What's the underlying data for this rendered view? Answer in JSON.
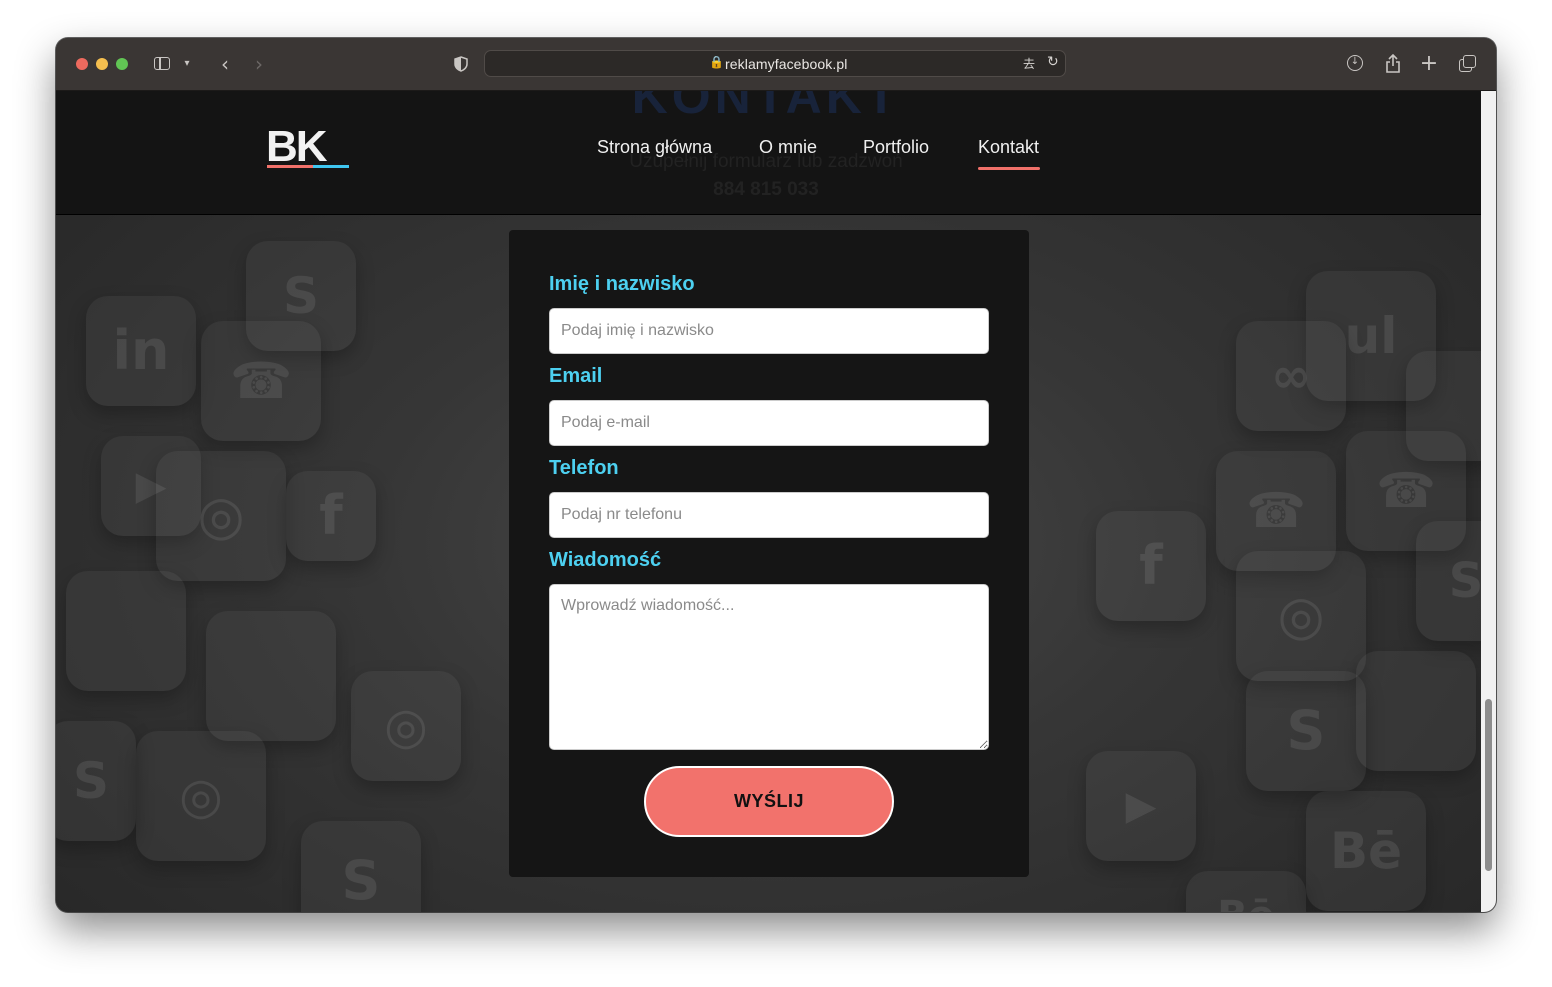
{
  "browser": {
    "url": "reklamyfacebook.pl",
    "icons": {
      "sidebar": "sidebar-icon",
      "back": "chevron-left-icon",
      "forward": "chevron-right-icon",
      "privacy": "shield-icon",
      "lock": "lock-icon",
      "translate": "translate-icon",
      "reload": "reload-icon",
      "download": "download-icon",
      "share": "share-icon",
      "new_tab": "plus-icon",
      "tabs": "tabs-overview-icon"
    }
  },
  "header": {
    "logo": "BK",
    "nav": [
      {
        "label": "Strona główna"
      },
      {
        "label": "O mnie"
      },
      {
        "label": "Portfolio"
      },
      {
        "label": "Kontakt",
        "active": true
      }
    ],
    "behind": {
      "title": "KONTAKT",
      "subtitle": "Uzupełnij formularz lub zadzwoń",
      "phone": "884 815 033"
    }
  },
  "form": {
    "name_label": "Imię i nazwisko",
    "name_placeholder": "Podaj imię i nazwisko",
    "email_label": "Email",
    "email_placeholder": "Podaj e-mail",
    "phone_label": "Telefon",
    "phone_placeholder": "Podaj nr telefonu",
    "message_label": "Wiadomość",
    "message_placeholder": "Wprowadź wiadomość...",
    "submit_label": "WYŚLIJ"
  },
  "colors": {
    "accent_blue": "#4dd0f0",
    "accent_coral": "#f2726c",
    "card_bg": "#151515",
    "header_bg": "#141414"
  }
}
